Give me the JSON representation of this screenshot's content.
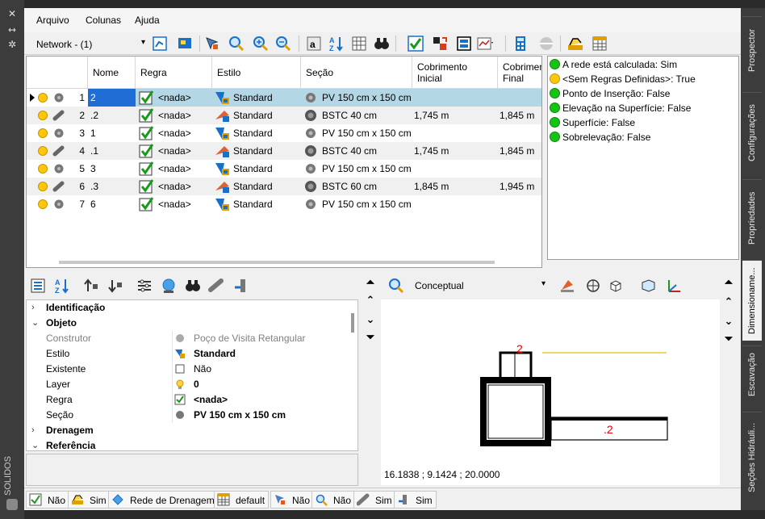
{
  "menu": [
    "Arquivo",
    "Colunas",
    "Ajuda"
  ],
  "toolbar": {
    "network_label": "Network - (1)"
  },
  "columns": [
    "Nome",
    "Regra",
    "Estilo",
    "Seção",
    "Cobrimento Inicial",
    "Cobrimento Final"
  ],
  "columns_split": {
    "cob1_a": "Cobrimento",
    "cob1_b": "Inicial",
    "cob2_a": "Cobrimen",
    "cob2_b": "Final"
  },
  "rows": [
    {
      "num": "1",
      "nome": "2",
      "regra": "<nada>",
      "estilo": "Standard",
      "secao": "PV 150 cm x 150 cm",
      "cob_ini": "",
      "cob_fim": "",
      "type": "structure"
    },
    {
      "num": "2",
      "nome": ".2",
      "regra": "<nada>",
      "estilo": "Standard",
      "secao": "BSTC 40 cm",
      "cob_ini": "1,745 m",
      "cob_fim": "1,845 m",
      "type": "pipe"
    },
    {
      "num": "3",
      "nome": "1",
      "regra": "<nada>",
      "estilo": "Standard",
      "secao": "PV 150 cm x 150 cm",
      "cob_ini": "",
      "cob_fim": "",
      "type": "structure"
    },
    {
      "num": "4",
      "nome": ".1",
      "regra": "<nada>",
      "estilo": "Standard",
      "secao": "BSTC 40 cm",
      "cob_ini": "1,745 m",
      "cob_fim": "1,845 m",
      "type": "pipe"
    },
    {
      "num": "5",
      "nome": "3",
      "regra": "<nada>",
      "estilo": "Standard",
      "secao": "PV 150 cm x 150 cm",
      "cob_ini": "",
      "cob_fim": "",
      "type": "structure"
    },
    {
      "num": "6",
      "nome": ".3",
      "regra": "<nada>",
      "estilo": "Standard",
      "secao": "BSTC 60 cm",
      "cob_ini": "1,845 m",
      "cob_fim": "1,945 m",
      "type": "pipe"
    },
    {
      "num": "7",
      "nome": "6",
      "regra": "<nada>",
      "estilo": "Standard",
      "secao": "PV 150 cm x 150 cm",
      "cob_ini": "",
      "cob_fim": "",
      "type": "structure"
    }
  ],
  "messages": [
    {
      "text": "A rede está calculada: Sim",
      "color": "#14c314"
    },
    {
      "text": "<Sem Regras Definidas>: True",
      "color": "#ffc60b"
    },
    {
      "text": "Ponto de Inserção: False",
      "color": "#14c314"
    },
    {
      "text": "Elevação na Superfície: False",
      "color": "#14c314"
    },
    {
      "text": "Superfície: False",
      "color": "#14c314"
    },
    {
      "text": "Sobrelevação: False",
      "color": "#14c314"
    }
  ],
  "properties": {
    "identificacao": "Identificação",
    "objeto": "Objeto",
    "construtor_k": "Construtor",
    "construtor_v": "Poço de Visita Retangular",
    "estilo_k": "Estilo",
    "estilo_v": "Standard",
    "existente_k": "Existente",
    "existente_v": "Não",
    "layer_k": "Layer",
    "layer_v": "0",
    "regra_k": "Regra",
    "regra_v": "<nada>",
    "secao_k": "Seção",
    "secao_v": "PV 150 cm x 150 cm",
    "drenagem": "Drenagem",
    "referencia": "Referência"
  },
  "viewport": {
    "visual_style": "Conceptual",
    "coords": "16.1838 ; 9.1424 ; 20.0000",
    "label_top": "2",
    "label_pipe": ".2"
  },
  "status": [
    {
      "label": "Não"
    },
    {
      "label": "Sim"
    },
    {
      "label": "Rede de Drenagem"
    },
    {
      "label": "default"
    },
    {
      "label": "Não"
    },
    {
      "label": "Não"
    },
    {
      "label": "Sim"
    },
    {
      "label": "Sim"
    }
  ],
  "left_title": "SOLIDOS",
  "right_tabs": [
    "Prospector",
    "Configurações",
    "Propriedades",
    "Dimensioname...",
    "Escavação",
    "Seções Hidráuli..."
  ]
}
